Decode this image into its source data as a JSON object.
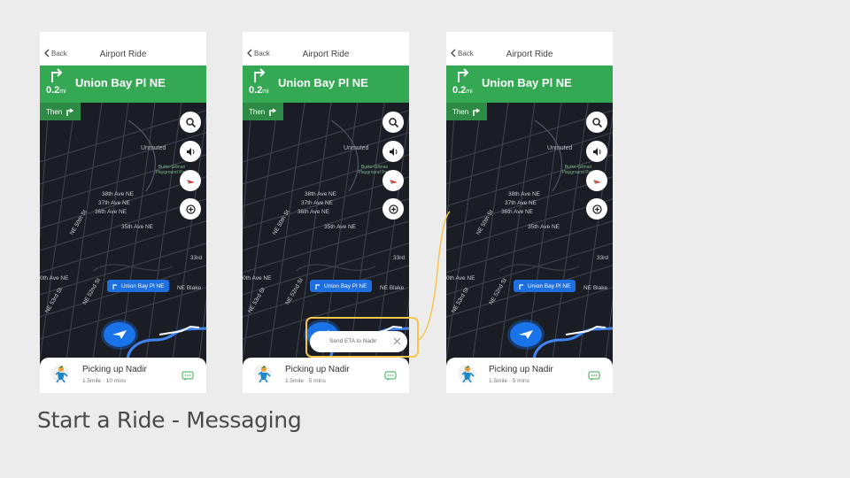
{
  "screens": [
    {
      "back_label": "Back",
      "title": "Airport Ride",
      "nav": {
        "distance": "0.2",
        "unit": "mi",
        "street": "Union Bay Pl NE",
        "then_label": "Then"
      },
      "map": {
        "unmuted_label": "Unmuted",
        "park_label": "Burke-Gilman Playground Park",
        "streets": [
          "38th Ave NE",
          "37th Ave NE",
          "36th Ave NE",
          "35th Ave NE",
          "33rd",
          "NE 50th St",
          "NE 52nd St",
          "NE 53rd St",
          "0th Ave NE",
          "NE Blake"
        ],
        "route_pill": "Union Bay Pl NE"
      },
      "bottom": {
        "status": "Picking up Nadir",
        "details": "1.5mile · 10 mins"
      }
    },
    {
      "back_label": "Back",
      "title": "Airport Ride",
      "nav": {
        "distance": "0.2",
        "unit": "mi",
        "street": "Union Bay Pl NE",
        "then_label": "Then"
      },
      "map": {
        "unmuted_label": "Unmuted",
        "park_label": "Burke-Gilman Playground Park",
        "streets": [
          "38th Ave NE",
          "37th Ave NE",
          "36th Ave NE",
          "35th Ave NE",
          "33rd",
          "NE 50th St",
          "NE 52nd St",
          "NE 53rd St",
          "0th Ave NE",
          "NE Blake"
        ],
        "route_pill": "Union Bay Pl NE"
      },
      "bottom": {
        "status": "Picking up Nadir",
        "details": "1.5mile · 5 mins"
      },
      "eta_prompt": "Send ETA to Nadir"
    },
    {
      "back_label": "Back",
      "title": "Airport Ride",
      "nav": {
        "distance": "0.2",
        "unit": "mi",
        "street": "Union Bay Pl NE",
        "then_label": "Then"
      },
      "map": {
        "unmuted_label": "Unmuted",
        "park_label": "Burke-Gilman Playground Park",
        "streets": [
          "38th Ave NE",
          "37th Ave NE",
          "36th Ave NE",
          "35th Ave NE",
          "33rd",
          "NE 50th St",
          "NE 52nd St",
          "NE 53rd St",
          "0th Ave NE",
          "NE Blake"
        ],
        "route_pill": "Union Bay Pl NE"
      },
      "bottom": {
        "status": "Picking up Nadir",
        "details": "1.5mile · 5 mins"
      }
    }
  ],
  "caption": "Start a Ride - Messaging",
  "colors": {
    "nav_green": "#34a853",
    "map_bg": "#1a1d24",
    "route_blue": "#1a73e8",
    "highlight": "#f5c451"
  },
  "icons": [
    "back-chevron-icon",
    "turn-right-icon",
    "search-icon",
    "speaker-icon",
    "compass-icon",
    "report-icon",
    "location-puck-icon",
    "chat-icon",
    "close-icon"
  ]
}
